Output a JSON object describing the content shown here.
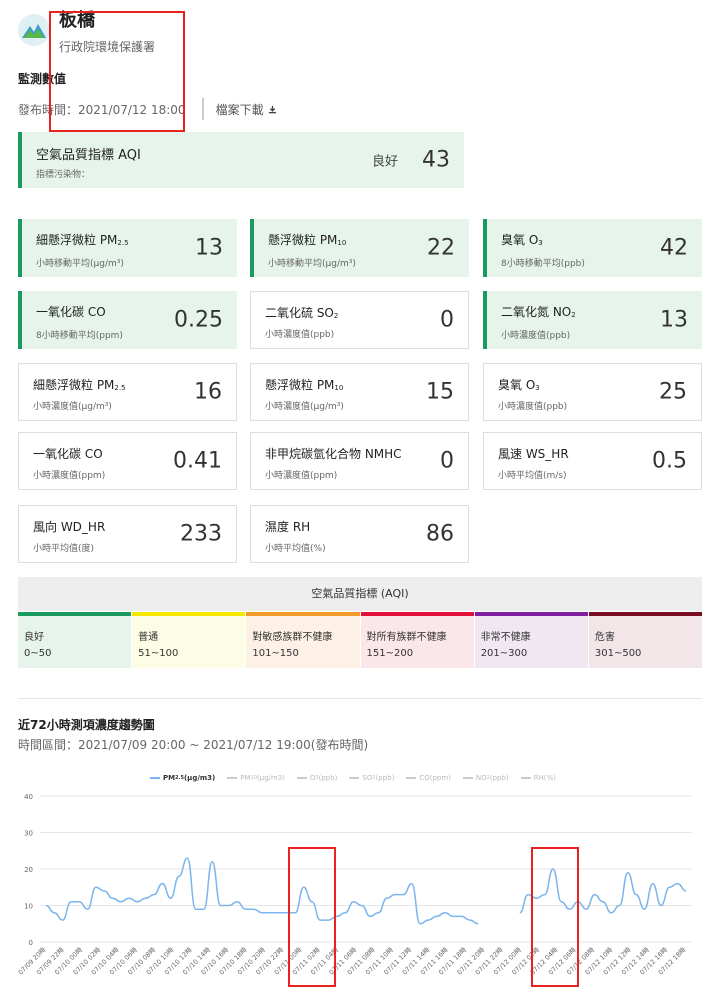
{
  "header": {
    "site_name": "板橋",
    "agency": "行政院環境保護署"
  },
  "section_label": "監測數值",
  "publish": {
    "label": "發布時間：2021/07/12 18:00",
    "download": "檔案下載"
  },
  "aqi_card": {
    "title": "空氣品質指標 AQI",
    "sub": "指標污染物：",
    "status": "良好",
    "value": "43"
  },
  "cards": [
    {
      "title": "細懸浮微粒 PM",
      "sub_s": "2.5",
      "unit": "小時移動平均(μg/m³)",
      "value": "13",
      "green": true
    },
    {
      "title": "懸浮微粒 PM",
      "sub_s": "10",
      "unit": "小時移動平均(μg/m³)",
      "value": "22",
      "green": true
    },
    {
      "title": "臭氧 O",
      "sub_s": "3",
      "unit": "8小時移動平均(ppb)",
      "value": "42",
      "green": true
    },
    {
      "title": "一氧化碳 CO",
      "sub_s": "",
      "unit": "8小時移動平均(ppm)",
      "value": "0.25",
      "green": true
    },
    {
      "title": "二氧化硫 SO",
      "sub_s": "2",
      "unit": "小時濃度值(ppb)",
      "value": "0",
      "green": false
    },
    {
      "title": "二氧化氮 NO",
      "sub_s": "2",
      "unit": "小時濃度值(ppb)",
      "value": "13",
      "green": true
    },
    {
      "title": "細懸浮微粒 PM",
      "sub_s": "2.5",
      "unit": "小時濃度值(μg/m³)",
      "value": "16",
      "green": false
    },
    {
      "title": "懸浮微粒 PM",
      "sub_s": "10",
      "unit": "小時濃度值(μg/m³)",
      "value": "15",
      "green": false
    },
    {
      "title": "臭氧 O",
      "sub_s": "3",
      "unit": "小時濃度值(ppb)",
      "value": "25",
      "green": false
    },
    {
      "title": "一氧化碳 CO",
      "sub_s": "",
      "unit": "小時濃度值(ppm)",
      "value": "0.41",
      "green": false
    },
    {
      "title": "非甲烷碳氫化合物 NMHC",
      "sub_s": "",
      "unit": "小時濃度值(ppm)",
      "value": "0",
      "green": false
    },
    {
      "title": "風速 WS_HR",
      "sub_s": "",
      "unit": "小時平均值(m/s)",
      "value": "0.5",
      "green": false
    },
    {
      "title": "風向 WD_HR",
      "sub_s": "",
      "unit": "小時平均值(度)",
      "value": "233",
      "green": false
    },
    {
      "title": "濕度 RH",
      "sub_s": "",
      "unit": "小時平均值(%)",
      "value": "86",
      "green": false
    }
  ],
  "aqi_legend": {
    "title": "空氣品質指標 (AQI)",
    "levels": [
      {
        "label": "良好",
        "range": "0~50",
        "bar": "#1a9a5c",
        "bg": "#e7f4ec"
      },
      {
        "label": "普通",
        "range": "51~100",
        "bar": "#f5e800",
        "bg": "#fdfde6"
      },
      {
        "label": "對敏感族群不健康",
        "range": "101~150",
        "bar": "#f39a2a",
        "bg": "#fdf1e6"
      },
      {
        "label": "對所有族群不健康",
        "range": "151~200",
        "bar": "#e0123a",
        "bg": "#fbe7ea"
      },
      {
        "label": "非常不健康",
        "range": "201~300",
        "bar": "#7f1fa0",
        "bg": "#f1e7f3"
      },
      {
        "label": "危害",
        "range": "301~500",
        "bar": "#7a0c22",
        "bg": "#f3e6e8"
      }
    ]
  },
  "trend": {
    "title": "近72小時測項濃度趨勢圖",
    "range": "時間區間：2021/07/09 20:00 ~ 2021/07/12 19:00(發布時間)"
  },
  "chart_data": {
    "type": "line",
    "legend": [
      {
        "name": "PM",
        "sub": "2.5",
        "suffix": "(μg/m3)",
        "active": true
      },
      {
        "name": "PM",
        "sub": "10",
        "suffix": "(μg/m3)",
        "active": false
      },
      {
        "name": "O",
        "sub": "3",
        "suffix": "(ppb)",
        "active": false
      },
      {
        "name": "SO",
        "sub": "2",
        "suffix": "(ppb)",
        "active": false
      },
      {
        "name": "CO",
        "sub": "",
        "suffix": "(ppm)",
        "active": false
      },
      {
        "name": "NO",
        "sub": "2",
        "suffix": "(ppb)",
        "active": false
      },
      {
        "name": "RH",
        "sub": "",
        "suffix": "(%)",
        "active": false
      }
    ],
    "y_ticks": [
      0,
      10,
      20,
      30,
      40
    ],
    "ylim": [
      0,
      40
    ],
    "x_tick_labels": [
      "07/09 20時",
      "07/09 22時",
      "07/10 00時",
      "07/10 02時",
      "07/10 04時",
      "07/10 06時",
      "07/10 08時",
      "07/10 10時",
      "07/10 12時",
      "07/10 14時",
      "07/10 16時",
      "07/10 18時",
      "07/10 20時",
      "07/10 22時",
      "07/11 00時",
      "07/11 02時",
      "07/11 04時",
      "07/11 06時",
      "07/11 08時",
      "07/11 10時",
      "07/11 12時",
      "07/11 14時",
      "07/11 16時",
      "07/11 18時",
      "07/11 20時",
      "07/11 22時",
      "07/12 00時",
      "07/12 02時",
      "07/12 04時",
      "07/12 06時",
      "07/12 08時",
      "07/12 10時",
      "07/12 12時",
      "07/12 14時",
      "07/12 16時",
      "07/12 18時"
    ],
    "series": [
      {
        "name": "PM2.5(μg/m3)",
        "color": "#7cb5ec",
        "values": [
          10,
          8,
          6,
          11,
          11,
          9,
          15,
          14,
          12,
          11,
          12,
          11,
          12,
          13,
          16,
          12,
          18,
          23,
          9,
          9,
          22,
          10,
          10,
          11,
          9,
          9,
          8,
          8,
          8,
          8,
          8,
          15,
          11,
          6,
          6,
          7,
          8,
          11,
          10,
          7,
          8,
          12,
          13,
          13,
          16,
          5,
          6,
          7,
          8,
          7,
          7,
          6,
          5,
          null,
          null,
          null,
          null,
          8,
          13,
          12,
          13,
          20,
          11,
          9,
          11,
          9,
          13,
          11,
          8,
          10,
          19,
          13,
          9,
          16,
          10,
          15,
          16,
          14
        ]
      }
    ]
  }
}
